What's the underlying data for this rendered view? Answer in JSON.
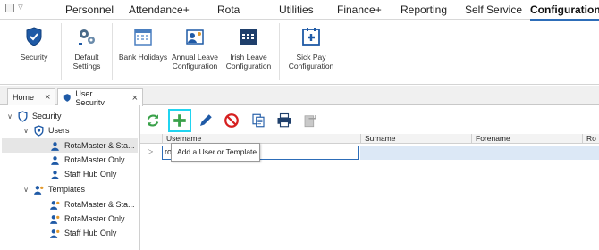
{
  "menu": {
    "items": [
      "Personnel",
      "Attendance+",
      "Rota",
      "Utilities",
      "Finance+",
      "Reporting",
      "Self Service",
      "Configuration"
    ],
    "active": "Configuration"
  },
  "ribbon": {
    "security": "Security",
    "default_settings_l1": "Default",
    "default_settings_l2": "Settings",
    "bank_holidays": "Bank Holidays",
    "annual_leave_l1": "Annual Leave",
    "annual_leave_l2": "Configuration",
    "irish_leave_l1": "Irish Leave",
    "irish_leave_l2": "Configuration",
    "sick_pay_l1": "Sick Pay",
    "sick_pay_l2": "Configuration"
  },
  "tabs": [
    {
      "label": "Home"
    },
    {
      "label": "User Security"
    }
  ],
  "tree": {
    "root": "Security",
    "users": "Users",
    "user_items": [
      "RotaMaster & Sta...",
      "RotaMaster Only",
      "Staff Hub Only"
    ],
    "templates": "Templates",
    "template_items": [
      "RotaMaster & Sta...",
      "RotaMaster Only",
      "Staff Hub Only"
    ]
  },
  "grid": {
    "columns": [
      "Username",
      "Surname",
      "Forename",
      "Ro"
    ],
    "row_value": "ro"
  },
  "tooltip": "Add a User or Template",
  "colors": {
    "accent": "#2d6db8",
    "highlight": "#20d4f0",
    "add_green": "#3aa14a",
    "delete_red": "#d62020"
  }
}
